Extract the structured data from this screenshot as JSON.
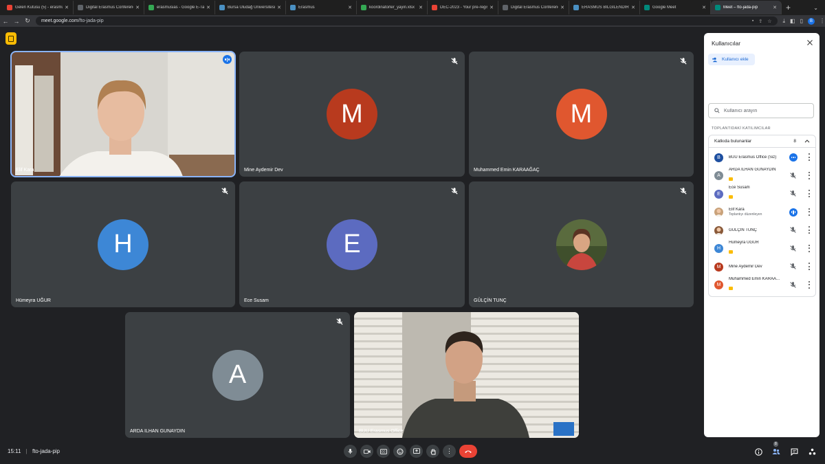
{
  "browser": {
    "tabs": [
      {
        "title": "Gelen Kutusu (5) - erasmus",
        "color": "#ea4335"
      },
      {
        "title": "Digital Erasmus Conference",
        "color": "#5f6368"
      },
      {
        "title": "erasmusias - Google E-Tab",
        "color": "#34a853"
      },
      {
        "title": "Bursa Uludağ Üniversitesi",
        "color": "#4a90c2"
      },
      {
        "title": "Erasmus",
        "color": "#4a90c2"
      },
      {
        "title": "koordinatorler_yayin.xlsx",
        "color": "#34a853"
      },
      {
        "title": "DEC-2023 - Your pre-regis",
        "color": "#ea4335"
      },
      {
        "title": "Digital Erasmus Conference",
        "color": "#5f6368"
      },
      {
        "title": "ERASMUS BİLGİLENDİRME",
        "color": "#4a90c2"
      },
      {
        "title": "Google Meet",
        "color": "#00897b"
      },
      {
        "title": "Meet – fto-jada-pip",
        "color": "#00897b"
      }
    ],
    "url_domain": "meet.google.com",
    "url_path": "/fto-jada-pip",
    "profile_initial": "B"
  },
  "tiles": [
    {
      "name": "Elif Kara",
      "type": "video",
      "speaking": true
    },
    {
      "name": "Mine Aydemir Dev",
      "initial": "M",
      "color": "#b83a1e",
      "muted": true
    },
    {
      "name": "Muhammed Emin KARAAĞAÇ",
      "initial": "M",
      "color": "#e0572f",
      "muted": true
    },
    {
      "name": "Hümeyra UĞUR",
      "initial": "H",
      "color": "#3d87d6",
      "muted": true
    },
    {
      "name": "Ece Susam",
      "initial": "E",
      "color": "#5c6bc0",
      "muted": true
    },
    {
      "name": "GÜLÇİN TUNÇ",
      "type": "photo",
      "muted": true
    },
    {
      "name": "ARDA ILHAN GUNAYDIN",
      "initial": "A",
      "color": "#7f8c95",
      "muted": true
    },
    {
      "name": "BUU Erasmus Office",
      "type": "video"
    }
  ],
  "bottombar": {
    "time": "15:11",
    "meeting_code": "fto-jada-pip",
    "people_count": "8"
  },
  "panel": {
    "title": "Kullanıcılar",
    "add_label": "Kullanıcı ekle",
    "search_placeholder": "Kullanıcı arayın",
    "section_label": "TOPLANTIDAKİ KATILIMCILAR",
    "group_label": "Katkıda bulunanlar",
    "group_count": "8",
    "people": [
      {
        "name": "BUU Erasmus Office (Siz)",
        "initial": "B",
        "color": "#1e4fa0",
        "state": "self"
      },
      {
        "name": "ARDA ILHAN GUNAYDIN",
        "initial": "A",
        "color": "#7f8c95",
        "state": "muted",
        "badge": true
      },
      {
        "name": "Ece Susam",
        "initial": "E",
        "color": "#5c6bc0",
        "state": "muted",
        "badge": true
      },
      {
        "name": "Elif Kara",
        "sub": "Toplantıyı düzenleyen",
        "initial": "",
        "color": "#c9a27a",
        "state": "speaking"
      },
      {
        "name": "GÜLÇİN TUNÇ",
        "initial": "",
        "color": "#8a5a3a",
        "state": "muted"
      },
      {
        "name": "Hümeyra UĞUR",
        "initial": "H",
        "color": "#3d87d6",
        "state": "muted",
        "badge": true
      },
      {
        "name": "Mine Aydemir Dev",
        "initial": "M",
        "color": "#b83a1e",
        "state": "muted"
      },
      {
        "name": "Muhammed Emin KARAA...",
        "initial": "M",
        "color": "#e0572f",
        "state": "muted",
        "badge": true
      }
    ]
  }
}
